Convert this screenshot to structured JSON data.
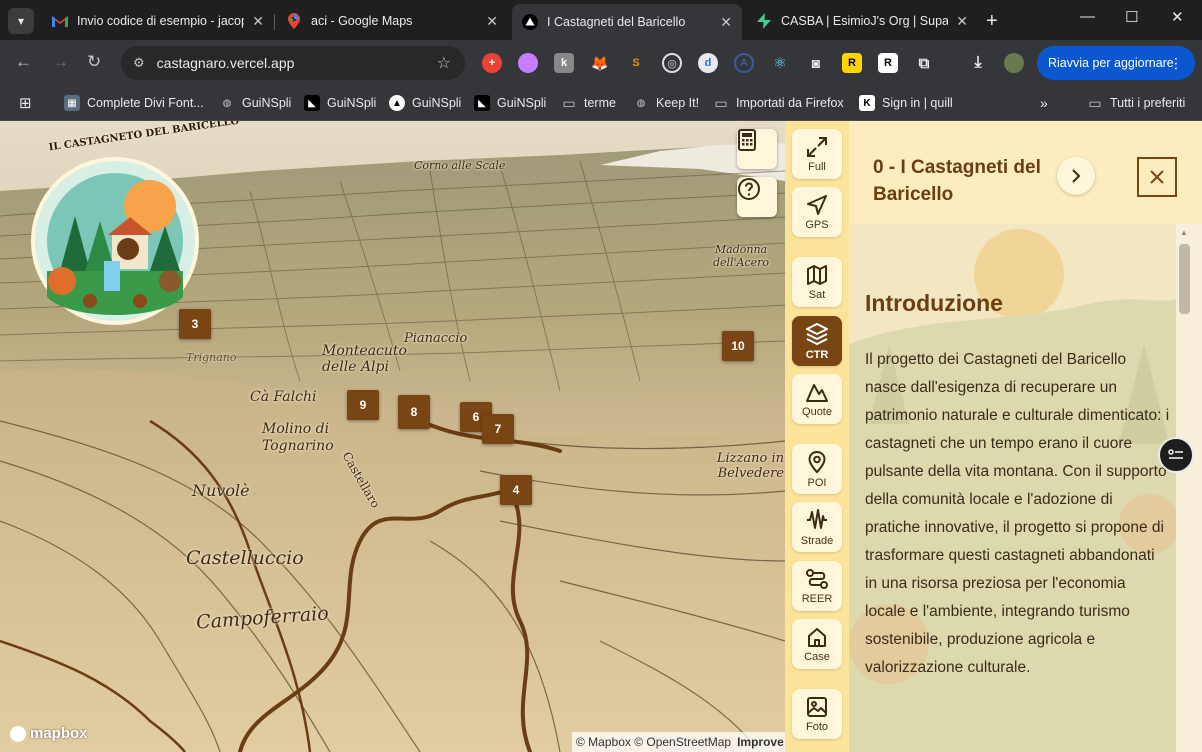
{
  "browser": {
    "tabs": [
      {
        "title": "Invio codice di esempio - jacop",
        "icon": "gmail-icon"
      },
      {
        "title": "aci - Google Maps",
        "icon": "maps-icon"
      },
      {
        "title": "I Castagneti del Baricello",
        "icon": "vercel-icon"
      },
      {
        "title": "CASBA | EsimioJ's Org | Supaba",
        "icon": "supabase-icon"
      }
    ],
    "url": "castagnaro.vercel.app",
    "update_button": "Riavvia per aggiornare",
    "bookmarks": [
      {
        "label": "Complete Divi Font..."
      },
      {
        "label": "GuiNSpli"
      },
      {
        "label": "GuiNSpli"
      },
      {
        "label": "GuiNSpli"
      },
      {
        "label": "GuiNSpli"
      },
      {
        "label": "terme"
      },
      {
        "label": "Keep It!"
      },
      {
        "label": "Importati da Firefox"
      },
      {
        "label": "Sign in | quill"
      }
    ],
    "all_bookmarks": "Tutti i preferiti"
  },
  "map": {
    "logo_title": "IL CASTAGNETO DEL BARICELLO",
    "markers": [
      "3",
      "10",
      "9",
      "8",
      "6",
      "7",
      "4"
    ],
    "place_names": [
      "Monteacuto delle Alpi",
      "Pianaccio",
      "Cà Falchi",
      "Molino di Tognarino",
      "Nuvolè",
      "Castelluccio",
      "Campoferraio",
      "Lizzano in Belvedere",
      "Madonna dell'Acero",
      "Corno alle Scale",
      "Castellaro",
      "Trignano"
    ],
    "attribution": "© Mapbox © OpenStreetMap",
    "attribution_link": "Improve",
    "mapbox_label": "mapbox"
  },
  "rail": {
    "buttons": [
      {
        "label": "Full",
        "icon": "fullscreen-icon"
      },
      {
        "label": "GPS",
        "icon": "gps-arrow-icon"
      },
      {
        "label": "Sat",
        "icon": "map-icon"
      },
      {
        "label": "CTR",
        "icon": "layers-icon"
      },
      {
        "label": "Quote",
        "icon": "mountain-icon"
      },
      {
        "label": "POI",
        "icon": "pin-icon"
      },
      {
        "label": "Strade",
        "icon": "road-icon"
      },
      {
        "label": "REER",
        "icon": "route-icon"
      },
      {
        "label": "Case",
        "icon": "home-icon"
      },
      {
        "label": "Foto",
        "icon": "photo-icon"
      }
    ],
    "active": "CTR"
  },
  "panel": {
    "title": "0 - I Castagneti del Baricello",
    "section_title": "Introduzione",
    "section_text": "Il progetto dei Castagneti del Baricello nasce dall'esigenza di recuperare un patrimonio naturale e culturale dimenticato: i castagneti che un tempo erano il cuore pulsante della vita montana. Con il supporto della comunità locale e l'adozione di pratiche innovative, il progetto si propone di trasformare questi castagneti abbandonati in una risorsa preziosa per l'economia locale e l'ambiente, integrando turismo sostenibile, produzione agricola e valorizzazione culturale."
  },
  "colors": {
    "brand_brown": "#7a4515",
    "rail_bg": "#fbe39a",
    "panel_bg": "#fdf3d4",
    "chrome_accent": "#0b57d0"
  }
}
